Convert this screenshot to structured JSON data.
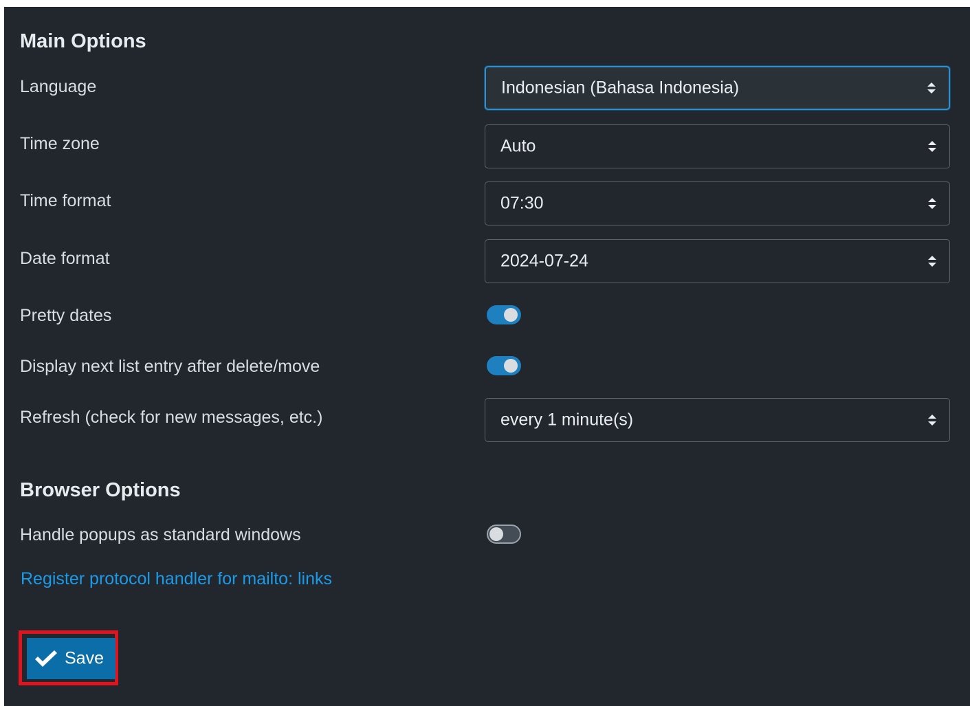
{
  "main_options": {
    "heading": "Main Options",
    "language": {
      "label": "Language",
      "value": "Indonesian (Bahasa Indonesia)"
    },
    "time_zone": {
      "label": "Time zone",
      "value": "Auto"
    },
    "time_format": {
      "label": "Time format",
      "value": "07:30"
    },
    "date_format": {
      "label": "Date format",
      "value": "2024-07-24"
    },
    "pretty_dates": {
      "label": "Pretty dates",
      "enabled": true
    },
    "display_next": {
      "label": "Display next list entry after delete/move",
      "enabled": true
    },
    "refresh": {
      "label": "Refresh (check for new messages, etc.)",
      "value": "every 1 minute(s)"
    }
  },
  "browser_options": {
    "heading": "Browser Options",
    "popups": {
      "label": "Handle popups as standard windows",
      "enabled": false
    },
    "protocol_link": "Register protocol handler for mailto: links"
  },
  "save_button": {
    "label": "Save",
    "icon": "checkmark-icon"
  },
  "colors": {
    "background": "#21272c",
    "accent": "#1f80c0",
    "link": "#1c9ae8",
    "save_button": "#0b6ea8",
    "highlight": "#e0141e"
  }
}
